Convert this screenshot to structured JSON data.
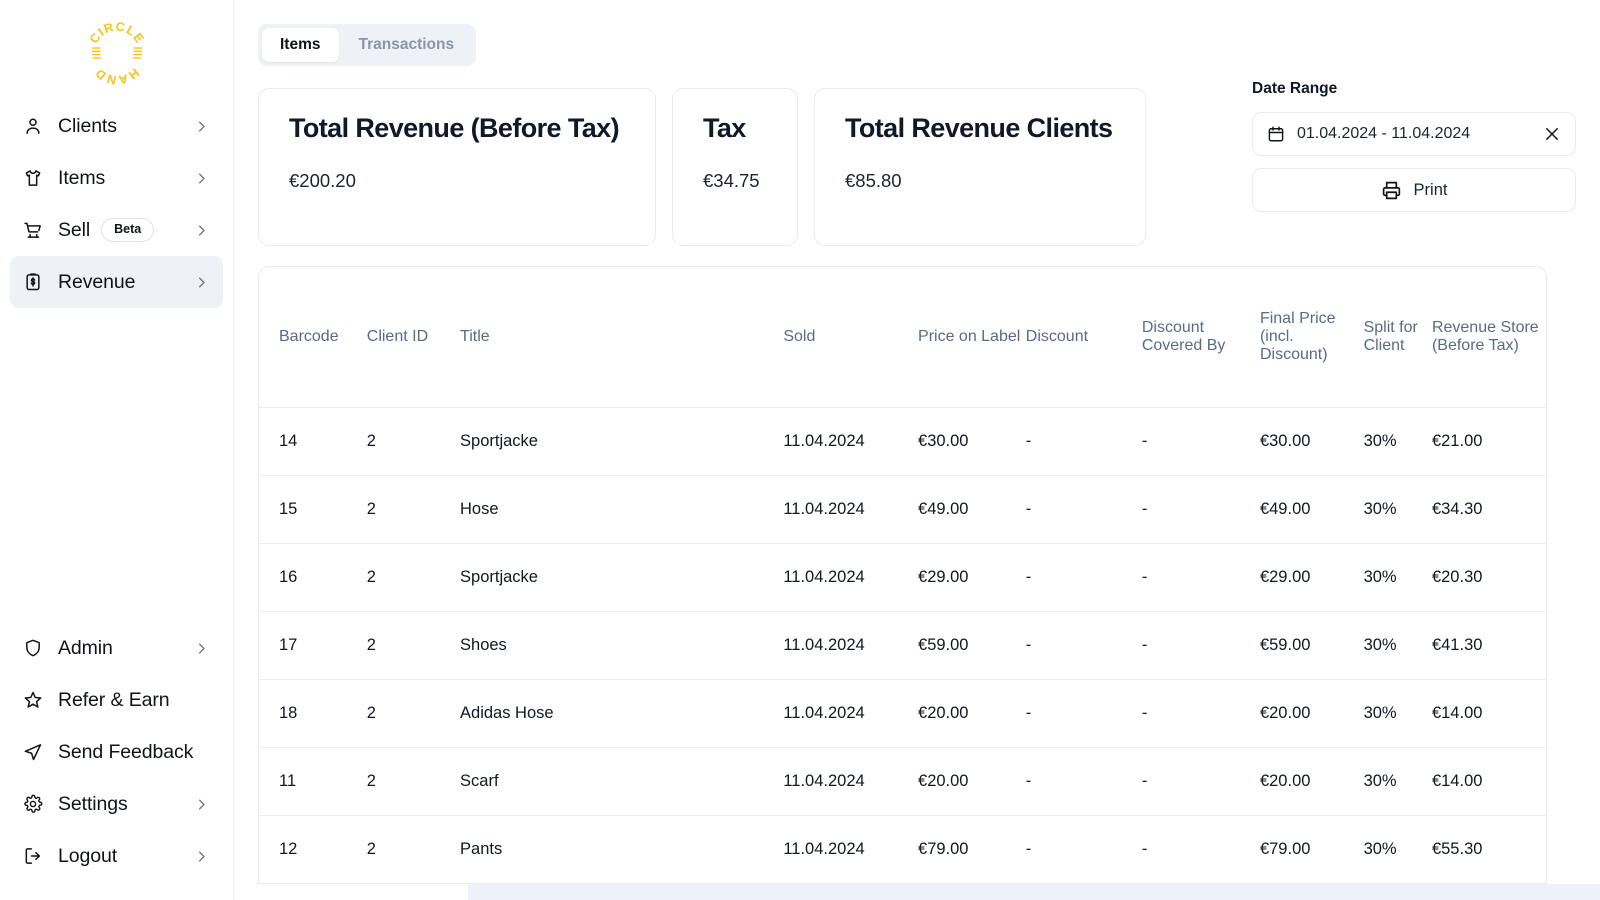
{
  "brand": {
    "logo_text_top": "CIRCLE",
    "logo_text_bottom": "HAND",
    "logo_color": "#F5C518"
  },
  "sidebar": {
    "top_items": [
      {
        "label": "Clients",
        "icon": "person-icon",
        "chevron": true,
        "badge": null,
        "active": false
      },
      {
        "label": "Items",
        "icon": "tshirt-icon",
        "chevron": true,
        "badge": null,
        "active": false
      },
      {
        "label": "Sell",
        "icon": "cart-icon",
        "chevron": true,
        "badge": "Beta",
        "active": false
      },
      {
        "label": "Revenue",
        "icon": "clipboard-money-icon",
        "chevron": true,
        "badge": null,
        "active": true
      }
    ],
    "bottom_items": [
      {
        "label": "Admin",
        "icon": "shield-icon",
        "chevron": true,
        "badge": null,
        "active": false
      },
      {
        "label": "Refer & Earn",
        "icon": "star-icon",
        "chevron": false,
        "badge": null,
        "active": false
      },
      {
        "label": "Send Feedback",
        "icon": "send-icon",
        "chevron": false,
        "badge": null,
        "active": false
      },
      {
        "label": "Settings",
        "icon": "gear-icon",
        "chevron": true,
        "badge": null,
        "active": false
      },
      {
        "label": "Logout",
        "icon": "logout-icon",
        "chevron": true,
        "badge": null,
        "active": false
      }
    ]
  },
  "tabs": [
    {
      "label": "Items",
      "active": true
    },
    {
      "label": "Transactions",
      "active": false
    }
  ],
  "cards": [
    {
      "title": "Total Revenue (Before Tax)",
      "value": "€200.20"
    },
    {
      "title": "Tax",
      "value": "€34.75"
    },
    {
      "title": "Total Revenue Clients",
      "value": "€85.80"
    }
  ],
  "controls": {
    "date_range_label": "Date Range",
    "date_range_value": "01.04.2024 - 11.04.2024",
    "calendar_icon": "calendar-icon",
    "clear_icon": "close-icon",
    "print_label": "Print",
    "print_icon": "printer-icon"
  },
  "table": {
    "columns": [
      "Barcode",
      "Client ID",
      "Title",
      "Sold",
      "Price on Label",
      "Discount",
      "Discount Covered By",
      "Final Price (incl. Discount)",
      "Split for Client",
      "Revenue Store (Before Tax)"
    ],
    "rows": [
      {
        "barcode": "14",
        "client_id": "2",
        "title": "Sportjacke",
        "sold": "11.04.2024",
        "price_on_label": "€30.00",
        "discount": "-",
        "discount_covered_by": "-",
        "final_price": "€30.00",
        "split_for_client": "30%",
        "revenue_store": "€21.00"
      },
      {
        "barcode": "15",
        "client_id": "2",
        "title": "Hose",
        "sold": "11.04.2024",
        "price_on_label": "€49.00",
        "discount": "-",
        "discount_covered_by": "-",
        "final_price": "€49.00",
        "split_for_client": "30%",
        "revenue_store": "€34.30"
      },
      {
        "barcode": "16",
        "client_id": "2",
        "title": "Sportjacke",
        "sold": "11.04.2024",
        "price_on_label": "€29.00",
        "discount": "-",
        "discount_covered_by": "-",
        "final_price": "€29.00",
        "split_for_client": "30%",
        "revenue_store": "€20.30"
      },
      {
        "barcode": "17",
        "client_id": "2",
        "title": "Shoes",
        "sold": "11.04.2024",
        "price_on_label": "€59.00",
        "discount": "-",
        "discount_covered_by": "-",
        "final_price": "€59.00",
        "split_for_client": "30%",
        "revenue_store": "€41.30"
      },
      {
        "barcode": "18",
        "client_id": "2",
        "title": "Adidas Hose",
        "sold": "11.04.2024",
        "price_on_label": "€20.00",
        "discount": "-",
        "discount_covered_by": "-",
        "final_price": "€20.00",
        "split_for_client": "30%",
        "revenue_store": "€14.00"
      },
      {
        "barcode": "11",
        "client_id": "2",
        "title": "Scarf",
        "sold": "11.04.2024",
        "price_on_label": "€20.00",
        "discount": "-",
        "discount_covered_by": "-",
        "final_price": "€20.00",
        "split_for_client": "30%",
        "revenue_store": "€14.00"
      },
      {
        "barcode": "12",
        "client_id": "2",
        "title": "Pants",
        "sold": "11.04.2024",
        "price_on_label": "€79.00",
        "discount": "-",
        "discount_covered_by": "-",
        "final_price": "€79.00",
        "split_for_client": "30%",
        "revenue_store": "€55.30"
      }
    ]
  },
  "colors": {
    "accent": "#F5C518",
    "sidebar_active_bg": "#EEF1F6",
    "border": "#E8EBF0",
    "header_text": "#5B6B85",
    "body_text": "#121722"
  }
}
